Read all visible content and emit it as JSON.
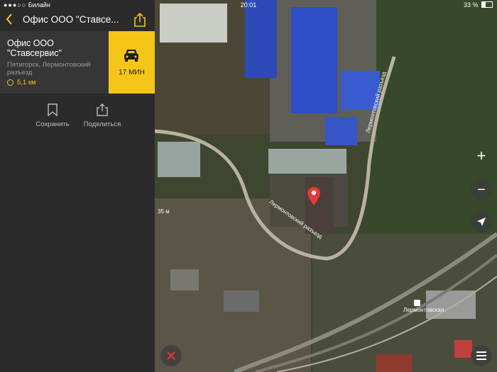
{
  "status_bar": {
    "carrier": "Билайн",
    "time": "20:01",
    "battery": "33 %"
  },
  "header": {
    "title": "Офис ООО \"Ставсе...",
    "back_icon": "chevron-left-icon",
    "share_icon": "share-icon"
  },
  "place": {
    "name": "Офис ООО \"Ставсервис\"",
    "address": "Пятигорск, Лермонтовский разъезд",
    "distance": "5,1 км"
  },
  "route": {
    "time": "17 МИН",
    "icon": "car-icon"
  },
  "actions": {
    "save": "Сохранить",
    "share": "Поделиться"
  },
  "map": {
    "road_label_1": "Лермонтовский разъезд",
    "road_label_2": "Лермонтовский разъезд",
    "station": "Лермонтовская",
    "height": "35 м"
  },
  "colors": {
    "accent": "#f5c518",
    "panel": "#2b2b2b"
  }
}
